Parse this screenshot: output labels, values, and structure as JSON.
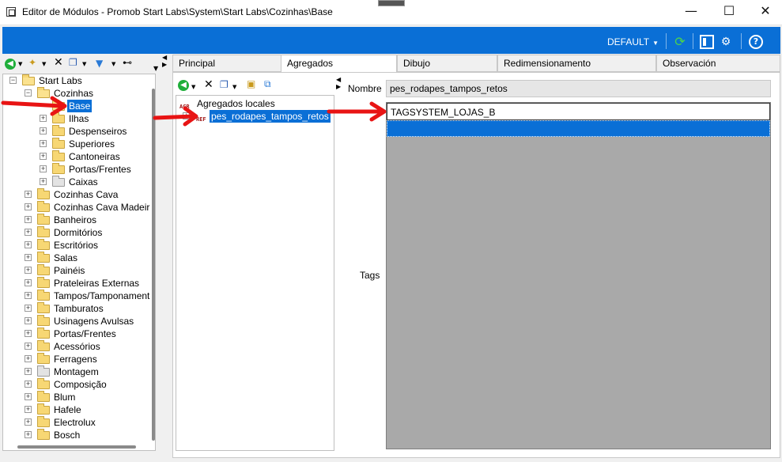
{
  "window": {
    "title": "Editor de Módulos - Promob Start Labs\\System\\Start Labs\\Cozinhas\\Base",
    "minimize": "—",
    "maximize": "☐",
    "close": "✕"
  },
  "topbar": {
    "profile": "DEFAULT",
    "icons": [
      "refresh-icon",
      "panel-icon",
      "settings-icon",
      "help-icon"
    ],
    "accent": "#0a6fd6"
  },
  "left_tree": {
    "root": "Start Labs",
    "level1_open": "Cozinhas",
    "cozinhas_children": [
      "Base",
      "Ilhas",
      "Despenseiros",
      "Superiores",
      "Cantoneiras",
      "Portas/Frentes",
      "Caixas"
    ],
    "selected": "Base",
    "siblings": [
      "Cozinhas Cava",
      "Cozinhas Cava Madeira",
      "Banheiros",
      "Dormitórios",
      "Escritórios",
      "Salas",
      "Painéis",
      "Prateleiras Externas",
      "Tampos/Tamponamento",
      "Tamburatos",
      "Usinagens Avulsas",
      "Portas/Frentes",
      "Acessórios",
      "Ferragens",
      "Montagem",
      "Composição",
      "Blum",
      "Hafele",
      "Electrolux",
      "Bosch"
    ]
  },
  "tabs": [
    "Principal",
    "Agregados",
    "Dibujo",
    "Redimensionamento",
    "Observación"
  ],
  "active_tab": "Agregados",
  "agregados": {
    "local_tag": "AGR",
    "local_label": "Agregados locales",
    "ref_tag": "REF",
    "ref_label": "pes_rodapes_tampos_retos"
  },
  "detail": {
    "nombre_label": "Nombre",
    "nombre_value": "pes_rodapes_tampos_retos",
    "tags_label": "Tags",
    "tags": [
      "TAGSYSTEM_LOJAS_B"
    ]
  }
}
